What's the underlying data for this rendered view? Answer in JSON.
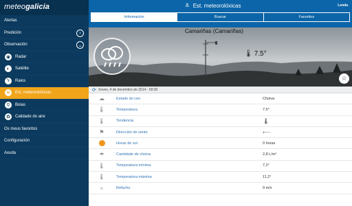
{
  "sidebar": {
    "logo": "meteo",
    "logo_bold": "galicia",
    "items": [
      {
        "label": "Alertas",
        "type": "plain"
      },
      {
        "label": "Predición",
        "type": "expand",
        "chev": "›"
      },
      {
        "label": "Observación",
        "type": "expand",
        "chev": "⌄"
      },
      {
        "label": "Radar",
        "type": "sub",
        "icon": "radar-icon",
        "glyph": "◉"
      },
      {
        "label": "Satélite",
        "type": "sub",
        "icon": "satellite-icon",
        "glyph": "◐"
      },
      {
        "label": "Raios",
        "type": "sub",
        "icon": "lightning-icon",
        "glyph": "ϟ"
      },
      {
        "label": "Est. meteorolóxicas",
        "type": "sub-active",
        "icon": "station-icon",
        "glyph": "≋"
      },
      {
        "label": "Boias",
        "type": "sub",
        "icon": "buoy-icon",
        "glyph": "⚲"
      },
      {
        "label": "Calidade do aire",
        "type": "sub",
        "icon": "air-quality-icon",
        "glyph": "✿"
      },
      {
        "label": "Os meus favoritos",
        "type": "plain"
      },
      {
        "label": "Configuración",
        "type": "plain"
      },
      {
        "label": "Axuda",
        "type": "plain"
      }
    ]
  },
  "header": {
    "title": "Est. meteorolóxicas",
    "title_glyph": "≚",
    "user": "Lenda",
    "tabs": [
      "Información",
      "Buscar",
      "Favoritos"
    ]
  },
  "hero": {
    "station": "Camariñas (Camariñas)",
    "temperature": "7.5°",
    "fav_glyph": "☆"
  },
  "date": "Xoves, 4 de decembro de 2014 - 09:30",
  "rows": [
    {
      "label": "Estado do ceo",
      "value": "Choiva",
      "icon": "cloud-icon",
      "glyph": "☁"
    },
    {
      "label": "Temperatura",
      "value": "7.5°",
      "icon": "thermometer-icon",
      "glyph": "🌡︎"
    },
    {
      "label": "Tendencia",
      "value": "",
      "icon": "thermometer-icon",
      "glyph": "🌡︎"
    },
    {
      "label": "Dirección do vento",
      "value": "",
      "icon": "wind-flag-icon",
      "glyph": "⚑"
    },
    {
      "label": "Horas de sol",
      "value": "0 horas",
      "icon": "sun-icon",
      "glyph": ""
    },
    {
      "label": "Cantidade de choiva",
      "value": "2,8 L/m²",
      "icon": "rain-cloud-icon",
      "glyph": "☂"
    },
    {
      "label": "Temperatura mínima",
      "value": "7,2°",
      "icon": "thermometer-min-icon",
      "glyph": "🌡︎"
    },
    {
      "label": "Temperatura máxima",
      "value": "11,2°",
      "icon": "thermometer-max-icon",
      "glyph": "🌡︎"
    },
    {
      "label": "Refacho",
      "value": "9 m/s",
      "icon": "gust-icon",
      "glyph": "≈"
    }
  ],
  "row_value_glyphs": {
    "tendencia": "🌡︎",
    "wind": "⟵"
  }
}
